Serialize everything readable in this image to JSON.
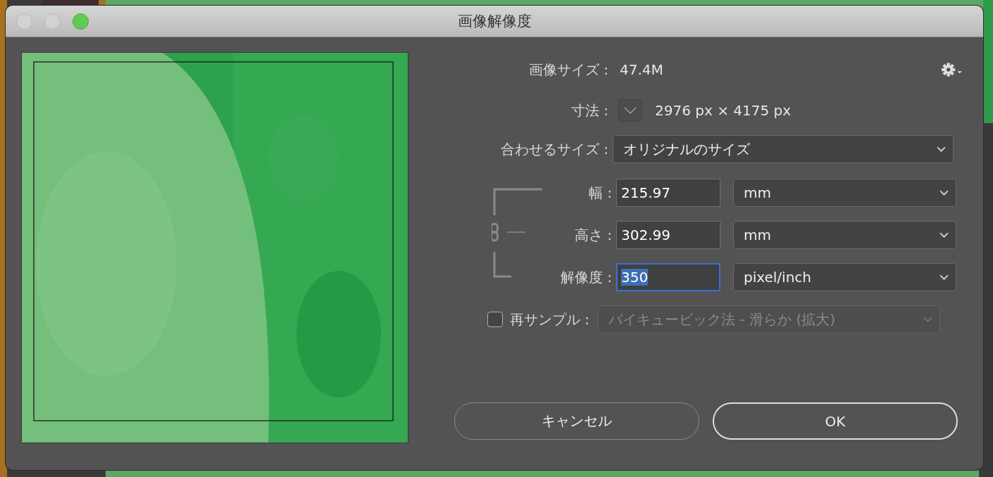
{
  "window": {
    "title": "画像解像度"
  },
  "image_size": {
    "label": "画像サイズ :",
    "value": "47.4M"
  },
  "dimensions": {
    "label": "寸法 :",
    "value": "2976 px × 4175 px"
  },
  "fit_to": {
    "label": "合わせるサイズ :",
    "value": "オリジナルのサイズ"
  },
  "fields": [
    {
      "label": "幅 :",
      "value": "215.97",
      "unit": "mm",
      "focused": false
    },
    {
      "label": "高さ :",
      "value": "302.99",
      "unit": "mm",
      "focused": false
    },
    {
      "label": "解像度 :",
      "value": "350",
      "unit": "pixel/inch",
      "focused": true
    }
  ],
  "resample": {
    "label": "再サンプル :",
    "checked": false,
    "method": "バイキュービック法 - 滑らか (拡大)",
    "disabled": true
  },
  "buttons": [
    {
      "label": "キャンセル",
      "default": false
    },
    {
      "label": "OK",
      "default": true
    }
  ]
}
